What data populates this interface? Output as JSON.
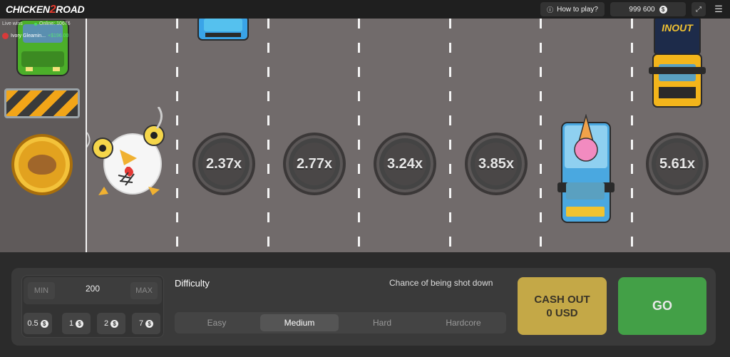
{
  "header": {
    "logo_text_a": "CHICKEN",
    "logo_text_b": "2",
    "logo_text_c": "ROAD",
    "how_to_play": "How to play?",
    "balance": "999 600",
    "currency_symbol": "$"
  },
  "feed": {
    "live_wins": "Live wins",
    "online": "Online: 10676",
    "entry_name": "Ivory Gleamin...",
    "entry_amount": "+$196.00"
  },
  "multipliers": [
    "2.37x",
    "2.77x",
    "3.24x",
    "3.85x",
    "5.61x"
  ],
  "truck_brand": "INOUT",
  "controls": {
    "min_label": "MIN",
    "max_label": "MAX",
    "bet_value": "200",
    "chips": [
      "0.5",
      "1",
      "2",
      "7"
    ],
    "difficulty_label": "Difficulty",
    "chance_label": "Chance of being shot down",
    "difficulties": [
      "Easy",
      "Medium",
      "Hard",
      "Hardcore"
    ],
    "selected_difficulty": "Medium",
    "cashout_line1": "CASH OUT",
    "cashout_line2": "0 USD",
    "go_label": "GO"
  },
  "colors": {
    "road": "#716b6b",
    "cashout": "#c4a847",
    "go": "#43a047"
  }
}
